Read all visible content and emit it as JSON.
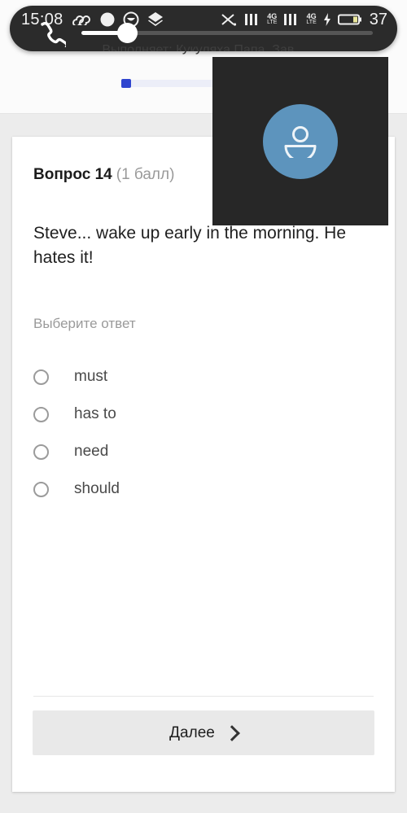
{
  "status_bar": {
    "clock": "15:08",
    "battery_percent": "37",
    "icons": [
      "infinity-icon",
      "filled-circle-icon",
      "smiley-circle-icon",
      "layers-diamond-icon",
      "silent-mute-icon",
      "signal-bars-icon",
      "signal-bars-icon",
      "charging-bolt-icon",
      "battery-icon"
    ],
    "network_1": {
      "tech": "4G",
      "mode": "LTE"
    },
    "network_2": {
      "tech": "4G",
      "mode": "LTE"
    }
  },
  "call_pill": {
    "caption": "Выполняет: Кукуляха Папа. Зав...",
    "phone_icon": "phone-handset-icon",
    "slider_value": 14
  },
  "call_panel": {
    "avatar_icon": "person-avatar-icon",
    "avatar_color": "#5d94bd",
    "panel_color": "#272727"
  },
  "header": {
    "attempt_text": "Выполняет: Кукуляха Папа. Зав...",
    "progress_count": "1",
    "progress_fill_color": "#2f45cf"
  },
  "question": {
    "label": "Вопрос 14",
    "points": "(1 балл)",
    "text": "Steve... wake up early in the morning. He hates it!",
    "choose_label": "Выберите ответ",
    "options": [
      {
        "label": "must",
        "selected": false
      },
      {
        "label": "has to",
        "selected": false
      },
      {
        "label": "need",
        "selected": false
      },
      {
        "label": "should",
        "selected": false
      }
    ]
  },
  "footer": {
    "next_label": "Далее",
    "next_icon": "chevron-right-icon"
  }
}
